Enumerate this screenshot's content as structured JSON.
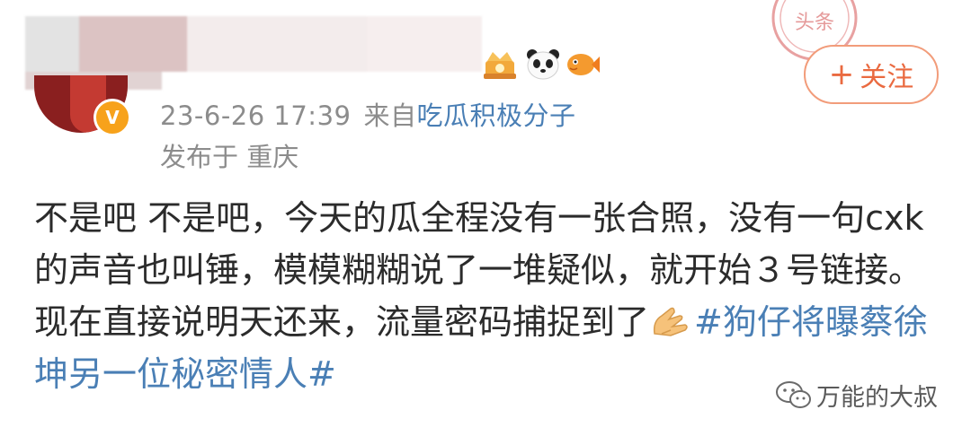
{
  "post": {
    "timestamp": "23-6-26 17:39",
    "source_prefix": "来自",
    "source_name": "吃瓜积极分子",
    "location_prefix": "发布于",
    "location": "重庆",
    "text_part1": "不是吧 不是吧，今天的瓜全程没有一张合照，没有一句cxk的声音也叫锤，模模糊糊说了一堆疑似，就开始３号链接。现在直接说明天还来，流量密码捕捉到了",
    "hashtag": "#狗仔将曝蔡徐坤另一位秘密情人#"
  },
  "follow_button": {
    "plus": "+",
    "label": "关注"
  },
  "stamp": {
    "text": "头条"
  },
  "watermark": {
    "text": "万能的大叔"
  },
  "colors": {
    "link": "#4a7fb5",
    "follow_accent": "#ea6a40",
    "meta_gray": "#8c8c8c"
  },
  "icons": {
    "verified": "verified-badge-icon",
    "hands": "folded-hands-emoji-icon",
    "watermark": "wechat-icon"
  }
}
